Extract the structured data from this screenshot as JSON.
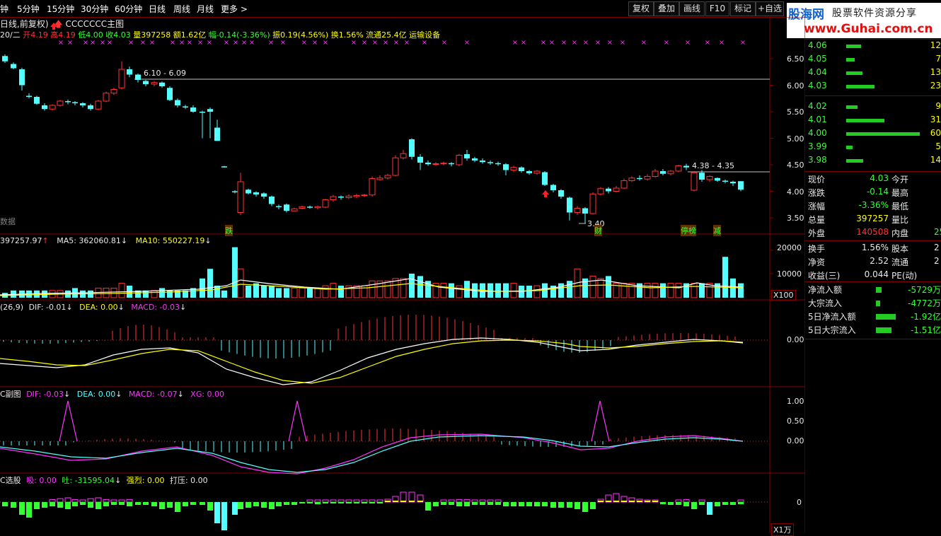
{
  "toolbar": {
    "timeframes": [
      "钟",
      "5分钟",
      "15分钟",
      "30分钟",
      "60分钟",
      "日线",
      "周线",
      "月线",
      "更多 >"
    ],
    "buttons": [
      "复权",
      "叠加",
      "画线",
      "F10",
      "标记",
      "+自选"
    ]
  },
  "logo": {
    "brand": "股海网",
    "tagline": "股票软件资源分享",
    "url": "www.Guhai.com.cn"
  },
  "info_line1": {
    "period": "日线,前复权)",
    "indicator": "CCCCCCC主图",
    "indicator_color": "#ff3232"
  },
  "info_line2": {
    "date": "20/二",
    "open_label": "开",
    "open": "4.19",
    "high_label": "高",
    "high": "4.19",
    "low_label": "低",
    "low": "4.00",
    "close_label": "收",
    "close": "4.03",
    "vol_label": "量",
    "vol": "397258",
    "amount_label": "额",
    "amount": "1.62亿",
    "range_label": "幅",
    "range": "-0.14(-3.36%)",
    "swing_label": "振",
    "swing": "0.19(4.56%)",
    "turnover_label": "换",
    "turnover": "1.56%",
    "float_label": "流通",
    "float": "25.4亿",
    "sector": "运输设备"
  },
  "price_axis": [
    "6.50",
    "6.00",
    "5.50",
    "5.00",
    "4.50",
    "4.00",
    "3.50"
  ],
  "annotations": {
    "range_high": "6.10 - 6.09",
    "range_mid": "4.38 - 4.35",
    "low_mark": "3.40",
    "missing_data": "数据",
    "tags": [
      "跌",
      "财",
      "停榜",
      "减"
    ]
  },
  "volume_panel": {
    "header_vol": "397257.97",
    "ma5": "MA5: 362060.81",
    "ma10": "MA10: 550227.19",
    "axis": [
      "20000",
      "10000"
    ],
    "unit": "X100"
  },
  "macd_panel": {
    "param": "(26,9)",
    "dif": "DIF: -0.01",
    "dea": "DEA: 0.00",
    "macd": "MACD: -0.03",
    "axis": [
      "0.00"
    ]
  },
  "macd2_panel": {
    "name": "C副图",
    "dif": "DIF: -0.03",
    "dea": "DEA: 0.00",
    "macd": "MACD: -0.07",
    "xg": "XG: 0.00",
    "axis": [
      "1.00",
      "0.50",
      "0.00"
    ]
  },
  "select_panel": {
    "name": "C选股",
    "xi": "吸: 0.00",
    "tu": "吐: -31595.04",
    "qiang": "强烈: 0.00",
    "daya": "打压: 0.00",
    "axis": [
      "0"
    ],
    "unit": "X1万"
  },
  "order_book": [
    {
      "price": "4.06",
      "vol": "12"
    },
    {
      "price": "4.05",
      "vol": "7"
    },
    {
      "price": "4.04",
      "vol": "13"
    },
    {
      "price": "4.03",
      "vol": "23"
    },
    {
      "price": "4.02",
      "vol": "9"
    },
    {
      "price": "4.01",
      "vol": "31"
    },
    {
      "price": "4.00",
      "vol": "60"
    },
    {
      "price": "3.99",
      "vol": "5"
    },
    {
      "price": "3.98",
      "vol": "14"
    }
  ],
  "quote": [
    {
      "l": "现价",
      "v": "4.03",
      "l2": "今开"
    },
    {
      "l": "涨跌",
      "v": "-0.14",
      "l2": "最高"
    },
    {
      "l": "涨幅",
      "v": "-3.36%",
      "l2": "最低"
    },
    {
      "l": "总量",
      "v": "397257",
      "l2": "量比"
    },
    {
      "l": "外盘",
      "v": "140508",
      "l2": "内盘",
      "v2": "25"
    },
    {
      "l": "换手",
      "v": "1.56%",
      "l2": "股本",
      "v2": "2"
    },
    {
      "l": "净资",
      "v": "2.52",
      "l2": "流通",
      "v2": "2"
    },
    {
      "l": "收益(三)",
      "v": "0.044",
      "l2": "PE(动)"
    }
  ],
  "flows": [
    {
      "l": "净流入额",
      "v": "-5729万"
    },
    {
      "l": "大宗流入",
      "v": "-4772万"
    },
    {
      "l": "5日净流入额",
      "v": "-1.92亿"
    },
    {
      "l": "5日大宗流入",
      "v": "-1.51亿"
    }
  ],
  "colors": {
    "up": "#ff3232",
    "down": "#54ffff",
    "yellow": "#ffff00",
    "magenta": "#ff33ff",
    "green": "#33ff33",
    "grid": "#800000"
  }
}
